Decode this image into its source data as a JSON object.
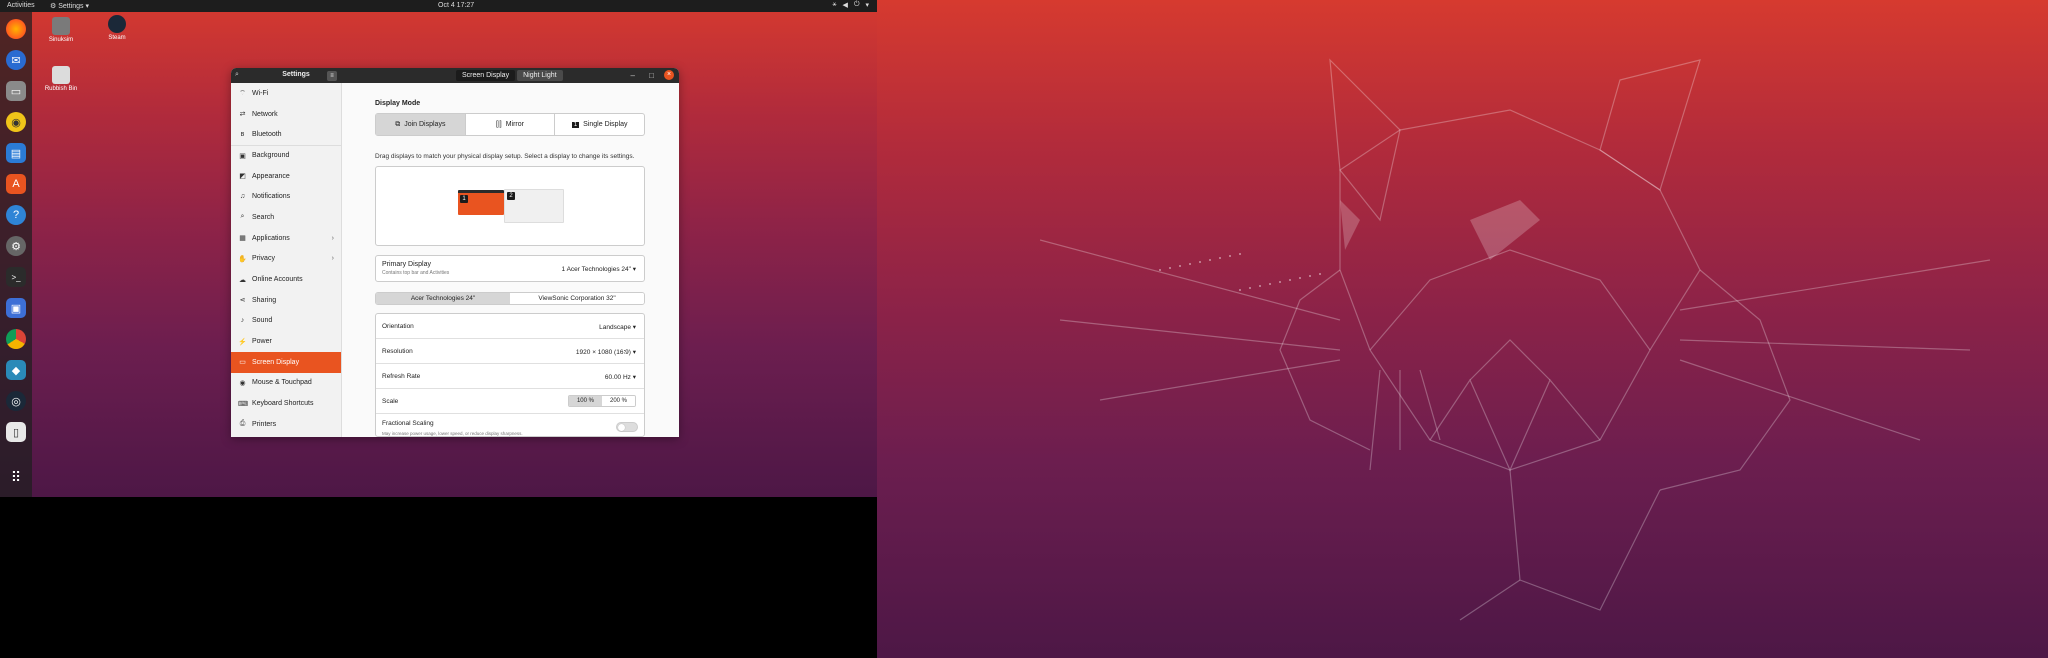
{
  "topbar": {
    "activities": "Activities",
    "app_menu": "Settings",
    "clock": "Oct 4  17:27"
  },
  "desktop": {
    "icons": [
      {
        "label": "Sinuksim"
      },
      {
        "label": "Steam"
      },
      {
        "label": "Rubbish Bin"
      }
    ]
  },
  "dock": {
    "apps": [
      "firefox-icon",
      "thunderbird-icon",
      "files-icon",
      "rhythmbox-icon",
      "libreoffice-writer-icon",
      "ubuntu-software-icon",
      "help-icon",
      "settings-icon",
      "terminal-icon",
      "screenshot-icon",
      "chrome-icon",
      "kodi-icon",
      "steam-icon",
      "text-editor-icon",
      "app-grid-icon"
    ]
  },
  "window": {
    "title": "Settings",
    "tabs": [
      "Screen Display",
      "Night Light"
    ],
    "controls": {
      "minimize": "–",
      "maximize": "□",
      "close": "×"
    }
  },
  "sidebar": {
    "items": [
      {
        "label": "Wi-Fi",
        "icon": "wifi-icon",
        "glyph": "⌔"
      },
      {
        "label": "Network",
        "icon": "network-icon",
        "glyph": "⇄"
      },
      {
        "label": "Bluetooth",
        "icon": "bluetooth-icon",
        "glyph": "ʙ"
      },
      {
        "label": "Background",
        "icon": "background-icon",
        "glyph": "▣"
      },
      {
        "label": "Appearance",
        "icon": "appearance-icon",
        "glyph": "◩"
      },
      {
        "label": "Notifications",
        "icon": "notifications-icon",
        "glyph": "♫"
      },
      {
        "label": "Search",
        "icon": "search-icon",
        "glyph": "⌕"
      },
      {
        "label": "Applications",
        "icon": "applications-icon",
        "glyph": "▦"
      },
      {
        "label": "Privacy",
        "icon": "privacy-icon",
        "glyph": "✋"
      },
      {
        "label": "Online Accounts",
        "icon": "online-accounts-icon",
        "glyph": "☁"
      },
      {
        "label": "Sharing",
        "icon": "sharing-icon",
        "glyph": "⋖"
      },
      {
        "label": "Sound",
        "icon": "sound-icon",
        "glyph": "♪"
      },
      {
        "label": "Power",
        "icon": "power-icon",
        "glyph": "⚡"
      },
      {
        "label": "Screen Display",
        "icon": "display-icon",
        "glyph": "▭"
      },
      {
        "label": "Mouse & Touchpad",
        "icon": "mouse-icon",
        "glyph": "◉"
      },
      {
        "label": "Keyboard Shortcuts",
        "icon": "keyboard-icon",
        "glyph": "⌨"
      },
      {
        "label": "Printers",
        "icon": "printer-icon",
        "glyph": "⎙"
      }
    ],
    "chevron": "›"
  },
  "display": {
    "mode_title": "Display Mode",
    "modes": [
      {
        "label": "Join Displays",
        "icon": "join-displays-icon",
        "glyph": "⧉"
      },
      {
        "label": "Mirror",
        "icon": "mirror-icon",
        "glyph": "[|]"
      },
      {
        "label": "Single Display",
        "icon": "single-display-icon",
        "glyph": "1"
      }
    ],
    "hint": "Drag displays to match your physical display setup. Select a display to change its settings.",
    "monitor1": "1",
    "monitor2": "2",
    "primary_label": "Primary Display",
    "primary_sub": "Contains top bar and Activities",
    "primary_value": "1  Acer Technologies 24\"  ▾",
    "monitor_tabs": [
      "Acer Technologies 24\"",
      "ViewSonic Corporation 32\""
    ],
    "orientation_label": "Orientation",
    "orientation_value": "Landscape  ▾",
    "resolution_label": "Resolution",
    "resolution_value": "1920 × 1080 (16∶9)  ▾",
    "refresh_label": "Refresh Rate",
    "refresh_value": "60.00 Hz  ▾",
    "scale_label": "Scale",
    "scale_options": [
      "100 %",
      "200 %"
    ],
    "fractional_label": "Fractional Scaling",
    "fractional_sub": "May increase power usage, lower speed, or reduce display sharpness."
  },
  "colors": {
    "accent": "#e95420",
    "titlebar": "#2b2b2b"
  }
}
